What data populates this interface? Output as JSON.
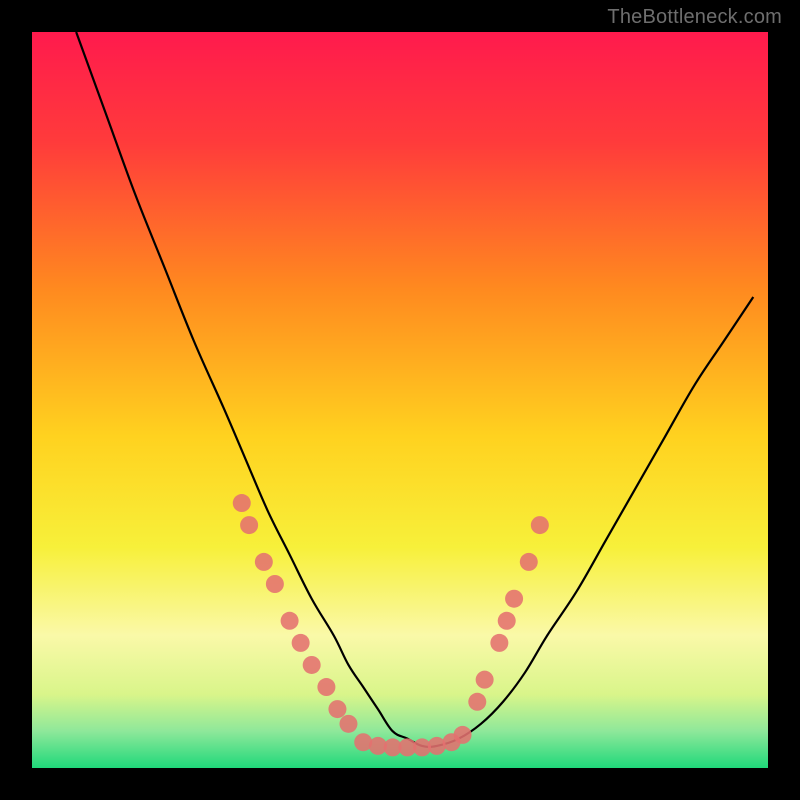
{
  "watermark": "TheBottleneck.com",
  "chart_data": {
    "type": "line",
    "title": "",
    "xlabel": "",
    "ylabel": "",
    "xlim": [
      0,
      100
    ],
    "ylim": [
      0,
      100
    ],
    "grid": false,
    "legend": false,
    "background": {
      "type": "vertical-gradient",
      "stops": [
        {
          "pos": 0.0,
          "color": "#ff1a4d"
        },
        {
          "pos": 0.15,
          "color": "#ff3b3b"
        },
        {
          "pos": 0.35,
          "color": "#ff8a1f"
        },
        {
          "pos": 0.55,
          "color": "#ffd21f"
        },
        {
          "pos": 0.7,
          "color": "#f7f03a"
        },
        {
          "pos": 0.82,
          "color": "#faf9a8"
        },
        {
          "pos": 0.9,
          "color": "#d9f58a"
        },
        {
          "pos": 0.95,
          "color": "#8ee89a"
        },
        {
          "pos": 1.0,
          "color": "#1fd87a"
        }
      ]
    },
    "series": [
      {
        "name": "bottleneck-curve",
        "color": "#000000",
        "x": [
          6,
          10,
          14,
          18,
          22,
          26,
          29,
          32,
          35,
          38,
          41,
          43,
          45,
          47,
          49,
          51,
          53,
          55,
          58,
          61,
          64,
          67,
          70,
          74,
          78,
          82,
          86,
          90,
          94,
          98
        ],
        "values": [
          100,
          89,
          78,
          68,
          58,
          49,
          42,
          35,
          29,
          23,
          18,
          14,
          11,
          8,
          5,
          4,
          3,
          3,
          4,
          6,
          9,
          13,
          18,
          24,
          31,
          38,
          45,
          52,
          58,
          64
        ]
      }
    ],
    "markers": {
      "name": "highlight-dots",
      "color": "#e4716f",
      "radius": 9,
      "points": [
        {
          "x": 28.5,
          "y": 36
        },
        {
          "x": 29.5,
          "y": 33
        },
        {
          "x": 31.5,
          "y": 28
        },
        {
          "x": 33.0,
          "y": 25
        },
        {
          "x": 35.0,
          "y": 20
        },
        {
          "x": 36.5,
          "y": 17
        },
        {
          "x": 38.0,
          "y": 14
        },
        {
          "x": 40.0,
          "y": 11
        },
        {
          "x": 41.5,
          "y": 8
        },
        {
          "x": 43.0,
          "y": 6
        },
        {
          "x": 45.0,
          "y": 3.5
        },
        {
          "x": 47.0,
          "y": 3.0
        },
        {
          "x": 49.0,
          "y": 2.8
        },
        {
          "x": 51.0,
          "y": 2.8
        },
        {
          "x": 53.0,
          "y": 2.8
        },
        {
          "x": 55.0,
          "y": 3.0
        },
        {
          "x": 57.0,
          "y": 3.5
        },
        {
          "x": 58.5,
          "y": 4.5
        },
        {
          "x": 60.5,
          "y": 9
        },
        {
          "x": 61.5,
          "y": 12
        },
        {
          "x": 63.5,
          "y": 17
        },
        {
          "x": 64.5,
          "y": 20
        },
        {
          "x": 65.5,
          "y": 23
        },
        {
          "x": 67.5,
          "y": 28
        },
        {
          "x": 69.0,
          "y": 33
        }
      ]
    }
  }
}
